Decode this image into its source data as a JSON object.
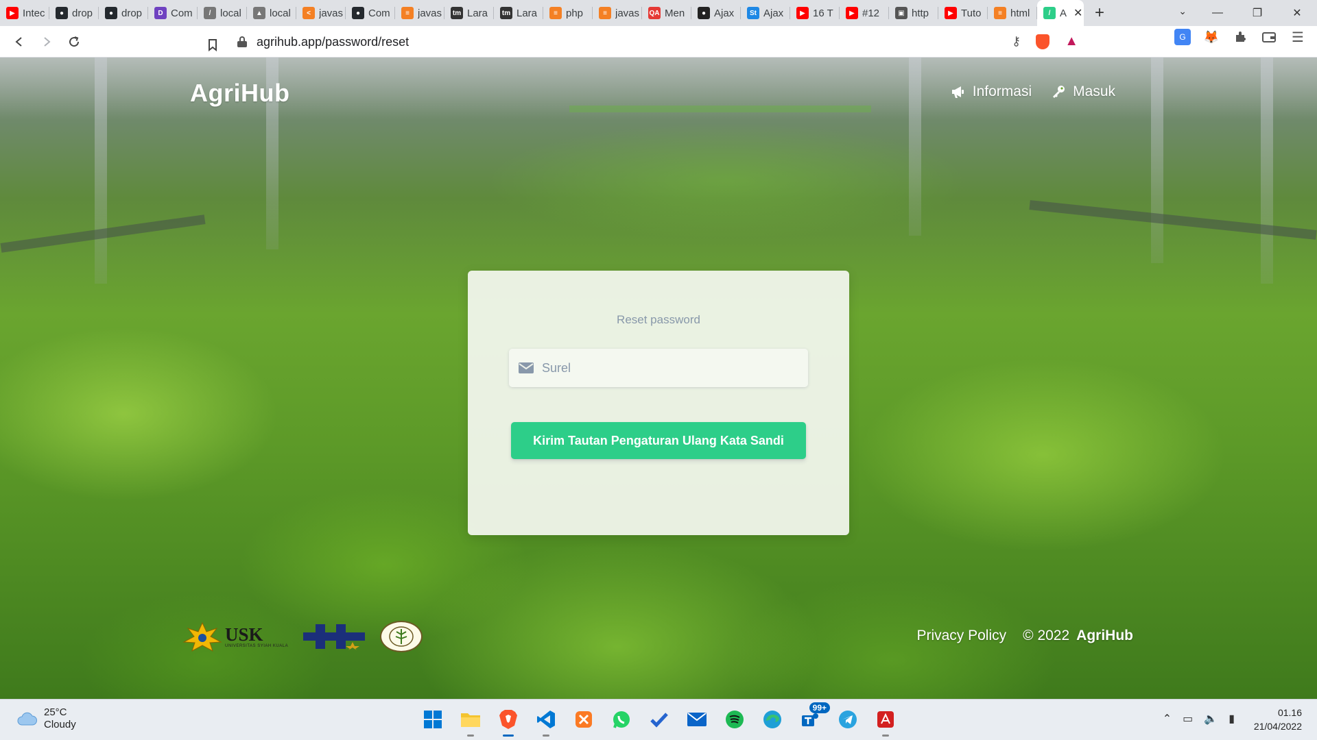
{
  "browser": {
    "tabs": [
      {
        "title": "Intec",
        "icon": "youtube-icon",
        "color": "#ff0000"
      },
      {
        "title": "drop",
        "icon": "github-icon",
        "color": "#24292e"
      },
      {
        "title": "drop",
        "icon": "github-icon",
        "color": "#24292e"
      },
      {
        "title": "Com",
        "icon": "app-icon",
        "color": "#6f42c1"
      },
      {
        "title": "local",
        "icon": "leaf-icon",
        "color": "#777777"
      },
      {
        "title": "local",
        "icon": "chart-icon",
        "color": "#777777"
      },
      {
        "title": "javas",
        "icon": "code-icon",
        "color": "#f48024"
      },
      {
        "title": "Com",
        "icon": "github-icon",
        "color": "#24292e"
      },
      {
        "title": "javas",
        "icon": "stackoverflow-icon",
        "color": "#f48024"
      },
      {
        "title": "Lara",
        "icon": "tm-icon",
        "color": "#333333"
      },
      {
        "title": "Lara",
        "icon": "tm-icon",
        "color": "#333333"
      },
      {
        "title": "php",
        "icon": "stackoverflow-icon",
        "color": "#f48024"
      },
      {
        "title": "javas",
        "icon": "stackoverflow-icon",
        "color": "#f48024"
      },
      {
        "title": "Men",
        "icon": "qa-icon",
        "color": "#e53935"
      },
      {
        "title": "Ajax",
        "icon": "circle-icon",
        "color": "#222222"
      },
      {
        "title": "Ajax",
        "icon": "st-icon",
        "color": "#1e88e5"
      },
      {
        "title": "16 T",
        "icon": "youtube-icon",
        "color": "#ff0000"
      },
      {
        "title": "#12",
        "icon": "youtube-icon",
        "color": "#ff0000"
      },
      {
        "title": "http",
        "icon": "box-icon",
        "color": "#555555"
      },
      {
        "title": "Tuto",
        "icon": "youtube-icon",
        "color": "#ff0000"
      },
      {
        "title": "html",
        "icon": "stackoverflow-icon",
        "color": "#f48024"
      }
    ],
    "active_tab": {
      "title": "A",
      "icon": "leaf-icon",
      "color": "#2dce89"
    },
    "url": "agrihub.app/password/reset"
  },
  "site": {
    "logo": "AgriHub",
    "nav": {
      "info": "Informasi",
      "login": "Masuk"
    }
  },
  "card": {
    "title": "Reset password",
    "email_placeholder": "Surel",
    "submit_label": "Kirim Tautan Pengaturan Ulang Kata Sandi"
  },
  "footer": {
    "usk_logo": "USK",
    "usk_sub": "UNIVERSITAS SYIAH KUALA",
    "privacy": "Privacy Policy",
    "copyright": "© 2022",
    "brand": "AgriHub"
  },
  "taskbar": {
    "temperature": "25°C",
    "weather": "Cloudy",
    "badge": "99+",
    "time": "01.16",
    "date": "21/04/2022"
  },
  "colors": {
    "accent": "#2dce89",
    "muted_text": "#8898aa"
  }
}
